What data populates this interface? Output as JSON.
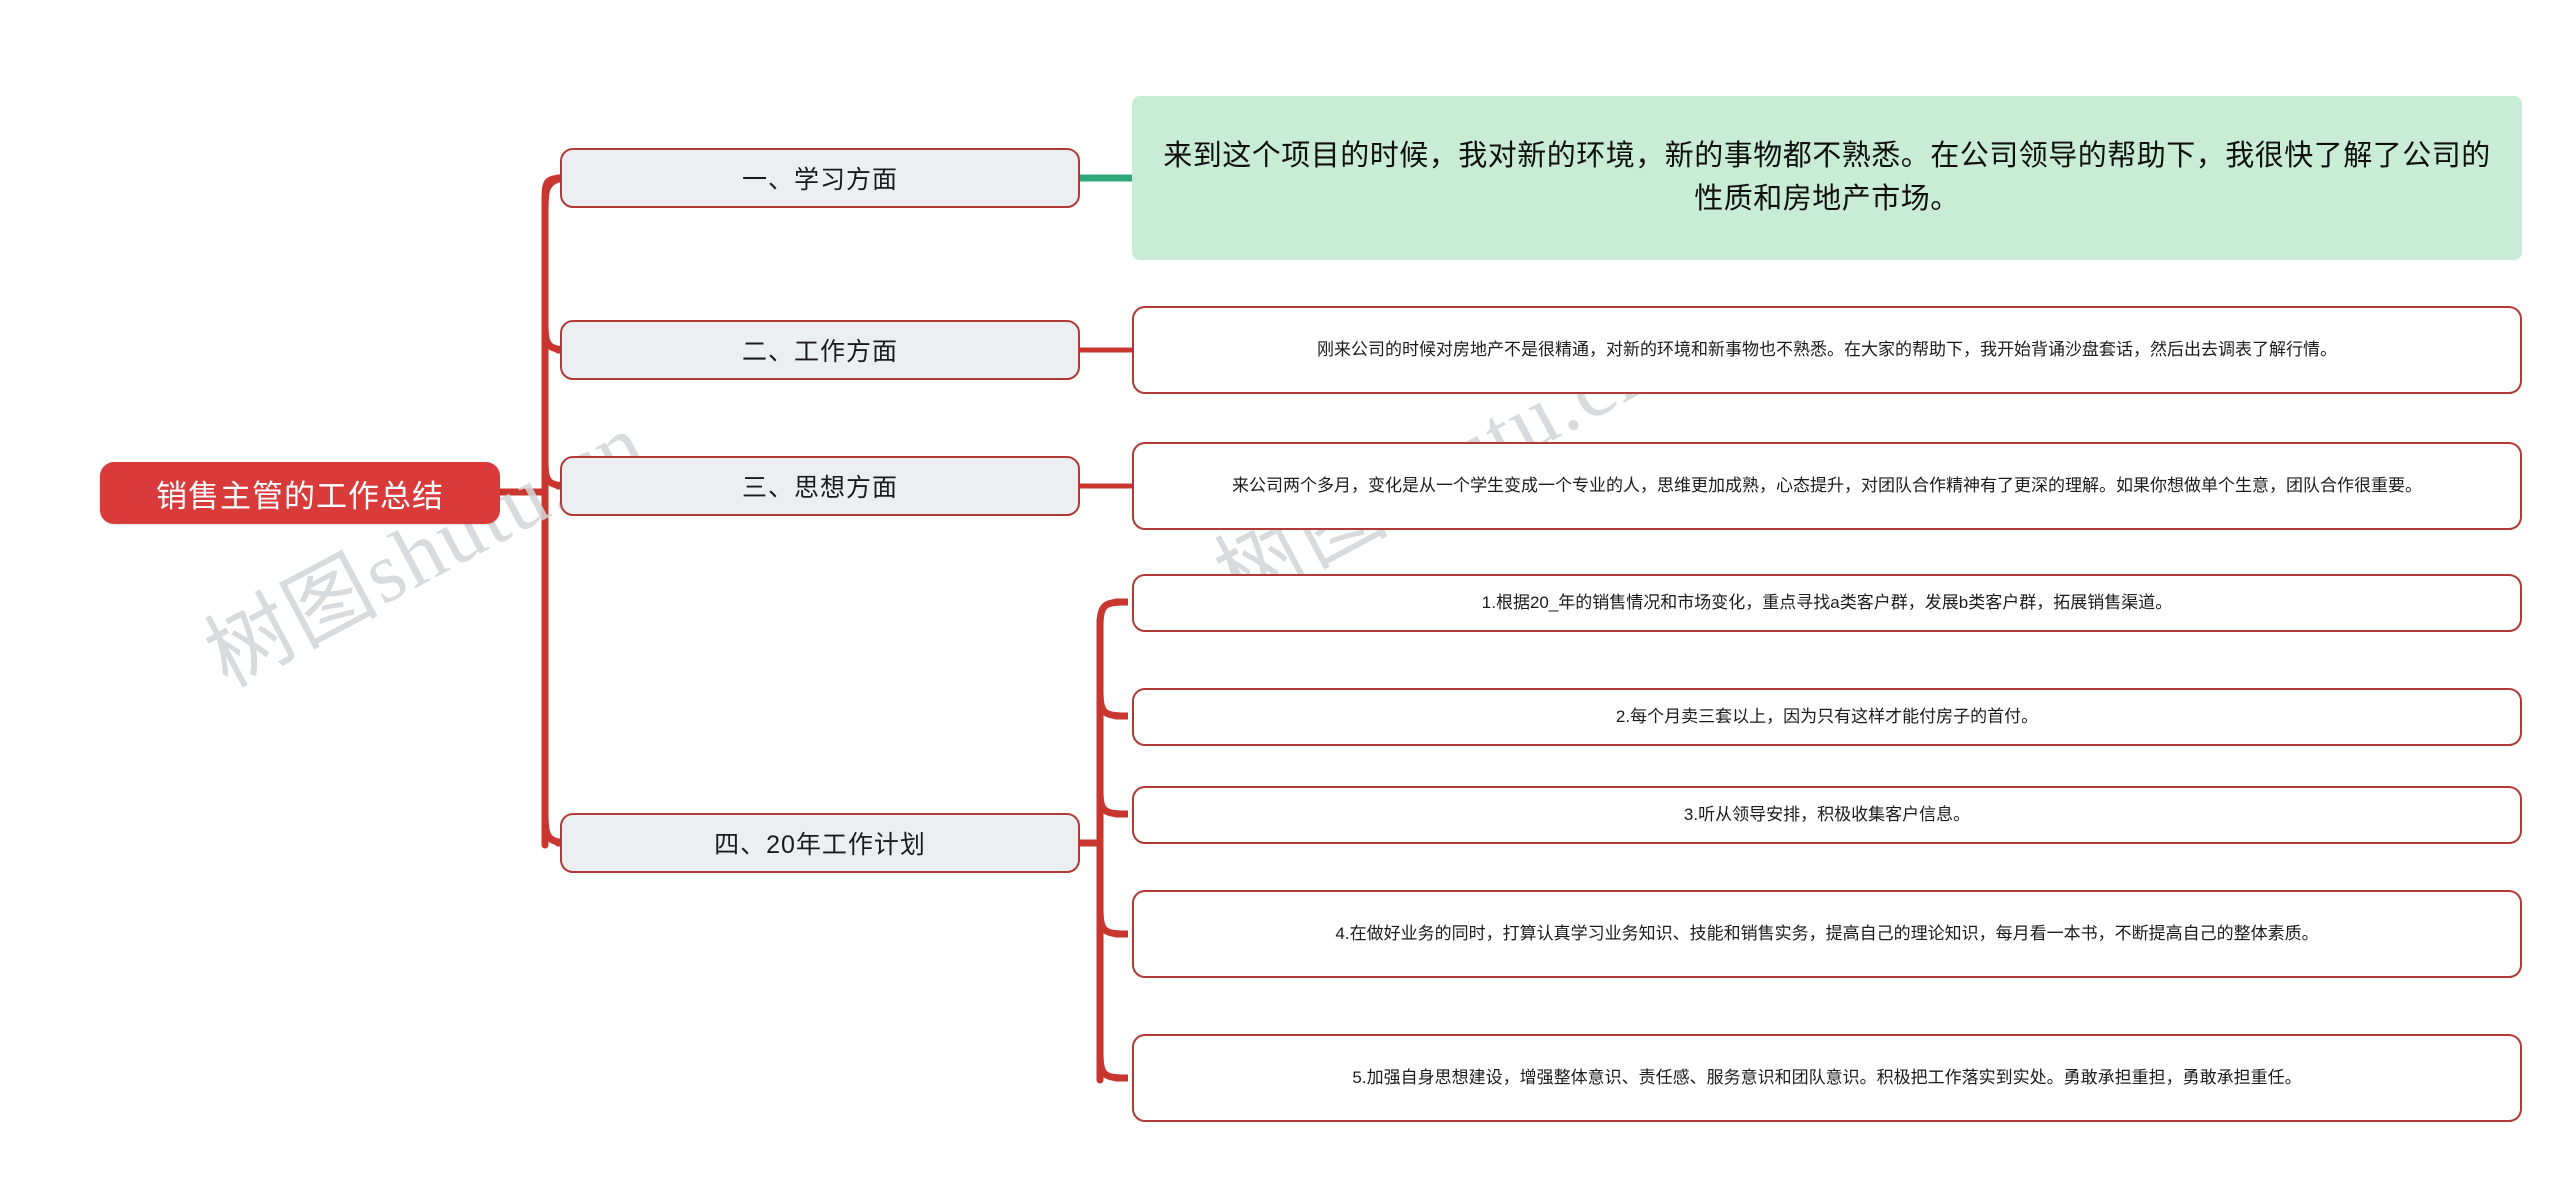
{
  "document": {
    "type": "mind-map",
    "title": "销售主管的工作总结",
    "watermark": "树图shutu.cn"
  },
  "colors": {
    "root_fill": "#d93b3b",
    "root_text": "#ffffff",
    "branch_fill": "#eceff2",
    "branch_border": "#b23a36",
    "leaf_fill": "#ffffff",
    "leaf_border": "#b23a36",
    "highlight_fill": "#c8ecd5",
    "connector_red": "#c9352f",
    "connector_green": "#2fa97c",
    "watermark_text": "#d2d5d8"
  },
  "root": {
    "label": "销售主管的工作总结"
  },
  "branches": [
    {
      "label": "一、学习方面",
      "connector_color": "#2fa97c",
      "children": [
        {
          "text": "来到这个项目的时候，我对新的环境，新的事物都不熟悉。在公司领导的帮助下，我很快了解了公司的性质和房地产市场。",
          "style": "highlight"
        }
      ]
    },
    {
      "label": "二、工作方面",
      "connector_color": "#c9352f",
      "children": [
        {
          "text": "刚来公司的时候对房地产不是很精通，对新的环境和新事物也不熟悉。在大家的帮助下，我开始背诵沙盘套话，然后出去调表了解行情。",
          "style": "plain"
        }
      ]
    },
    {
      "label": "三、思想方面",
      "connector_color": "#c9352f",
      "children": [
        {
          "text": "来公司两个多月，变化是从一个学生变成一个专业的人，思维更加成熟，心态提升，对团队合作精神有了更深的理解。如果你想做单个生意，团队合作很重要。",
          "style": "plain"
        }
      ]
    },
    {
      "label": "四、20年工作计划",
      "connector_color": "#c9352f",
      "children": [
        {
          "text": "1.根据20_年的销售情况和市场变化，重点寻找a类客户群，发展b类客户群，拓展销售渠道。",
          "style": "plain"
        },
        {
          "text": "2.每个月卖三套以上，因为只有这样才能付房子的首付。",
          "style": "plain"
        },
        {
          "text": "3.听从领导安排，积极收集客户信息。",
          "style": "plain"
        },
        {
          "text": "4.在做好业务的同时，打算认真学习业务知识、技能和销售实务，提高自己的理论知识，每月看一本书，不断提高自己的整体素质。",
          "style": "plain"
        },
        {
          "text": "5.加强自身思想建设，增强整体意识、责任感、服务意识和团队意识。积极把工作落实到实处。勇敢承担重担，勇敢承担重任。",
          "style": "plain"
        }
      ]
    }
  ]
}
